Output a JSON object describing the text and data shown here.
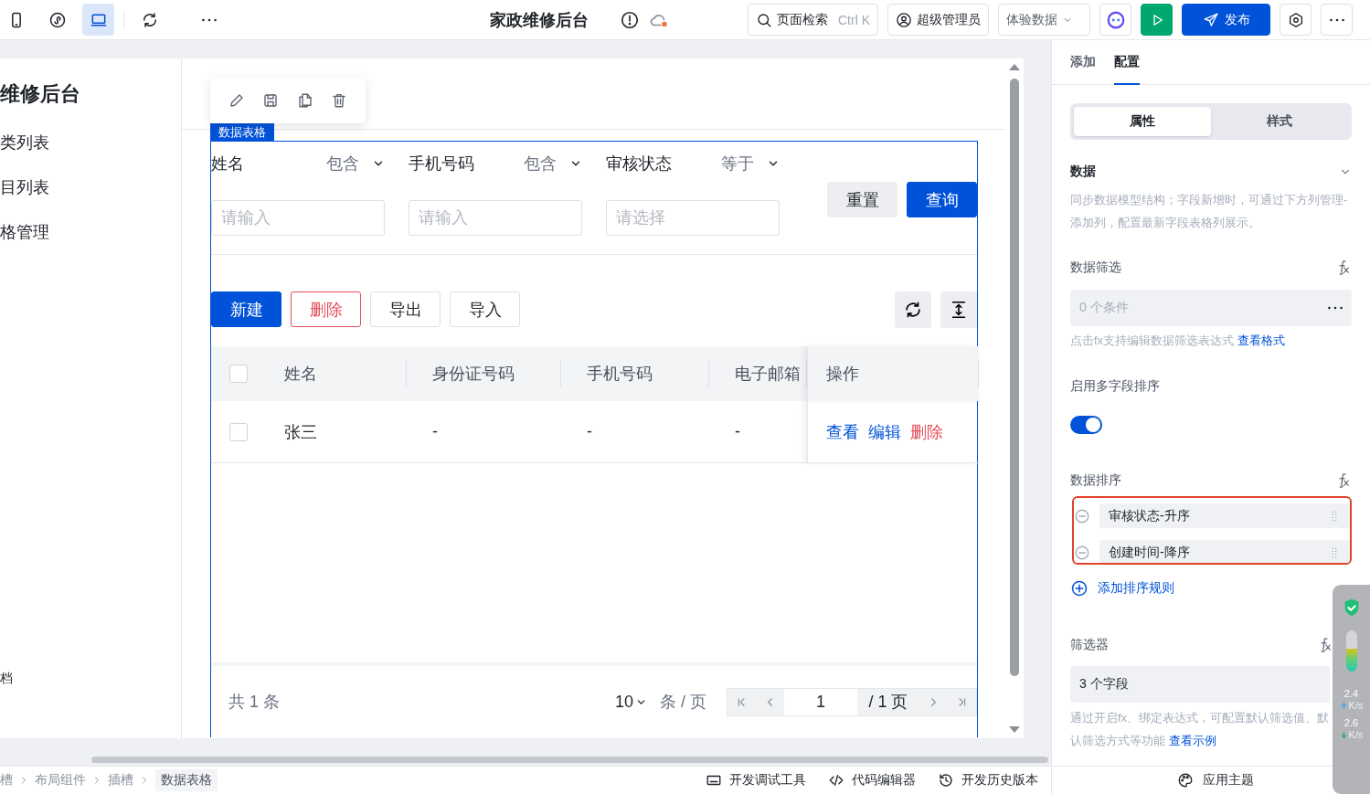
{
  "toolbar": {
    "device_buttons": [
      {
        "kind": "phone",
        "selected": false
      },
      {
        "kind": "miniapp",
        "selected": false
      },
      {
        "kind": "desktop",
        "selected": true
      }
    ],
    "title": "家政维修后台",
    "search": {
      "label": "页面检索",
      "shortcut": "Ctrl K"
    },
    "user": "超级管理员",
    "data_source": "体验数据",
    "publish": "发布"
  },
  "preview": {
    "sidebar": {
      "title": "维修后台",
      "items": [
        "类列表",
        "目列表",
        "格管理"
      ],
      "footer_item": "档"
    },
    "widget": {
      "badge": "数据表格",
      "filters": [
        {
          "label": "姓名",
          "operator": "包含",
          "placeholder": "请输入"
        },
        {
          "label": "手机号码",
          "operator": "包含",
          "placeholder": "请输入"
        },
        {
          "label": "审核状态",
          "operator": "等于",
          "placeholder": "请选择"
        }
      ],
      "filter_buttons": [
        {
          "label": "重置",
          "kind": "default"
        },
        {
          "label": "查询",
          "kind": "primary"
        }
      ],
      "actions": [
        {
          "label": "新建",
          "kind": "primary"
        },
        {
          "label": "删除",
          "kind": "danger"
        },
        {
          "label": "导出",
          "kind": "default"
        },
        {
          "label": "导入",
          "kind": "default"
        }
      ],
      "table": {
        "header_checked": false,
        "columns": [
          "姓名",
          "身份证号码",
          "手机号码",
          "电子邮箱",
          "操作"
        ],
        "rows": [
          {
            "checked": false,
            "cells": [
              "张三",
              "-",
              "-",
              "-"
            ],
            "actions": [
              {
                "label": "查看",
                "kind": "link"
              },
              {
                "label": "编辑",
                "kind": "link"
              },
              {
                "label": "删除",
                "kind": "danger"
              }
            ]
          }
        ]
      },
      "pagination": {
        "total": "共 1 条",
        "page_size": "10",
        "page_size_unit": "条 / 页",
        "page": "1",
        "page_count": "/ 1 页"
      }
    }
  },
  "panel": {
    "tabs": [
      {
        "label": "添加",
        "selected": false
      },
      {
        "label": "配置",
        "selected": true
      }
    ],
    "segments": [
      {
        "label": "属性",
        "selected": true
      },
      {
        "label": "样式",
        "selected": false
      }
    ],
    "section": {
      "title": "数据",
      "expanded": true,
      "description": "同步数据模型结构；字段新增时，可通过下方列管理-添加列，配置最新字段表格列展示。"
    },
    "data_filter": {
      "label": "数据筛选",
      "value": "0 个条件",
      "hint": "点击fx支持编辑数据筛选表达式",
      "link": "查看格式"
    },
    "multi_sort": {
      "label": "启用多字段排序",
      "on": true
    },
    "sort": {
      "label": "数据排序",
      "rules": [
        "审核状态-升序",
        "创建时间-降序"
      ],
      "add": "添加排序规则"
    },
    "filterer": {
      "label": "筛选器",
      "value": "3 个字段",
      "hint": "通过开启fx、绑定表达式，可配置默认筛选值、默认筛选方式等功能",
      "link": "查看示例"
    },
    "theme": "应用主题"
  },
  "status_bar": {
    "breadcrumb": [
      "槽",
      "布局组件",
      "插槽",
      "数据表格"
    ],
    "tools": [
      {
        "label": "开发调试工具",
        "kind": "debug"
      },
      {
        "label": "代码编辑器",
        "kind": "code"
      },
      {
        "label": "开发历史版本",
        "kind": "history"
      }
    ]
  },
  "net_monitor": {
    "level": 0.55,
    "upload": "2.4",
    "upload_unit": "K/s",
    "download": "2.6",
    "download_unit": "K/s"
  }
}
